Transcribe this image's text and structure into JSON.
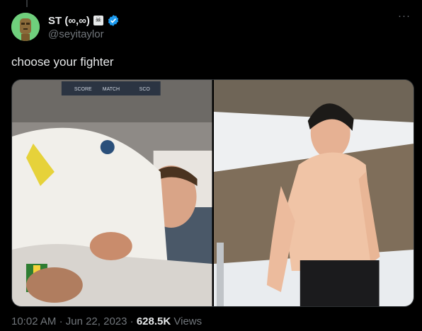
{
  "author": {
    "display_name": "ST (∞,∞)",
    "emoji_badge": "☠",
    "handle": "@seyitaylor",
    "verified_color": "#1d9bf0"
  },
  "more_label": "···",
  "tweet": {
    "text": "choose your fighter"
  },
  "media": {
    "left_banner": [
      "SCORE",
      "MATCH",
      "SCO"
    ]
  },
  "meta": {
    "time": "10:02 AM",
    "separator": "·",
    "date": "Jun 22, 2023",
    "views_count": "628.5K",
    "views_label": "Views"
  }
}
